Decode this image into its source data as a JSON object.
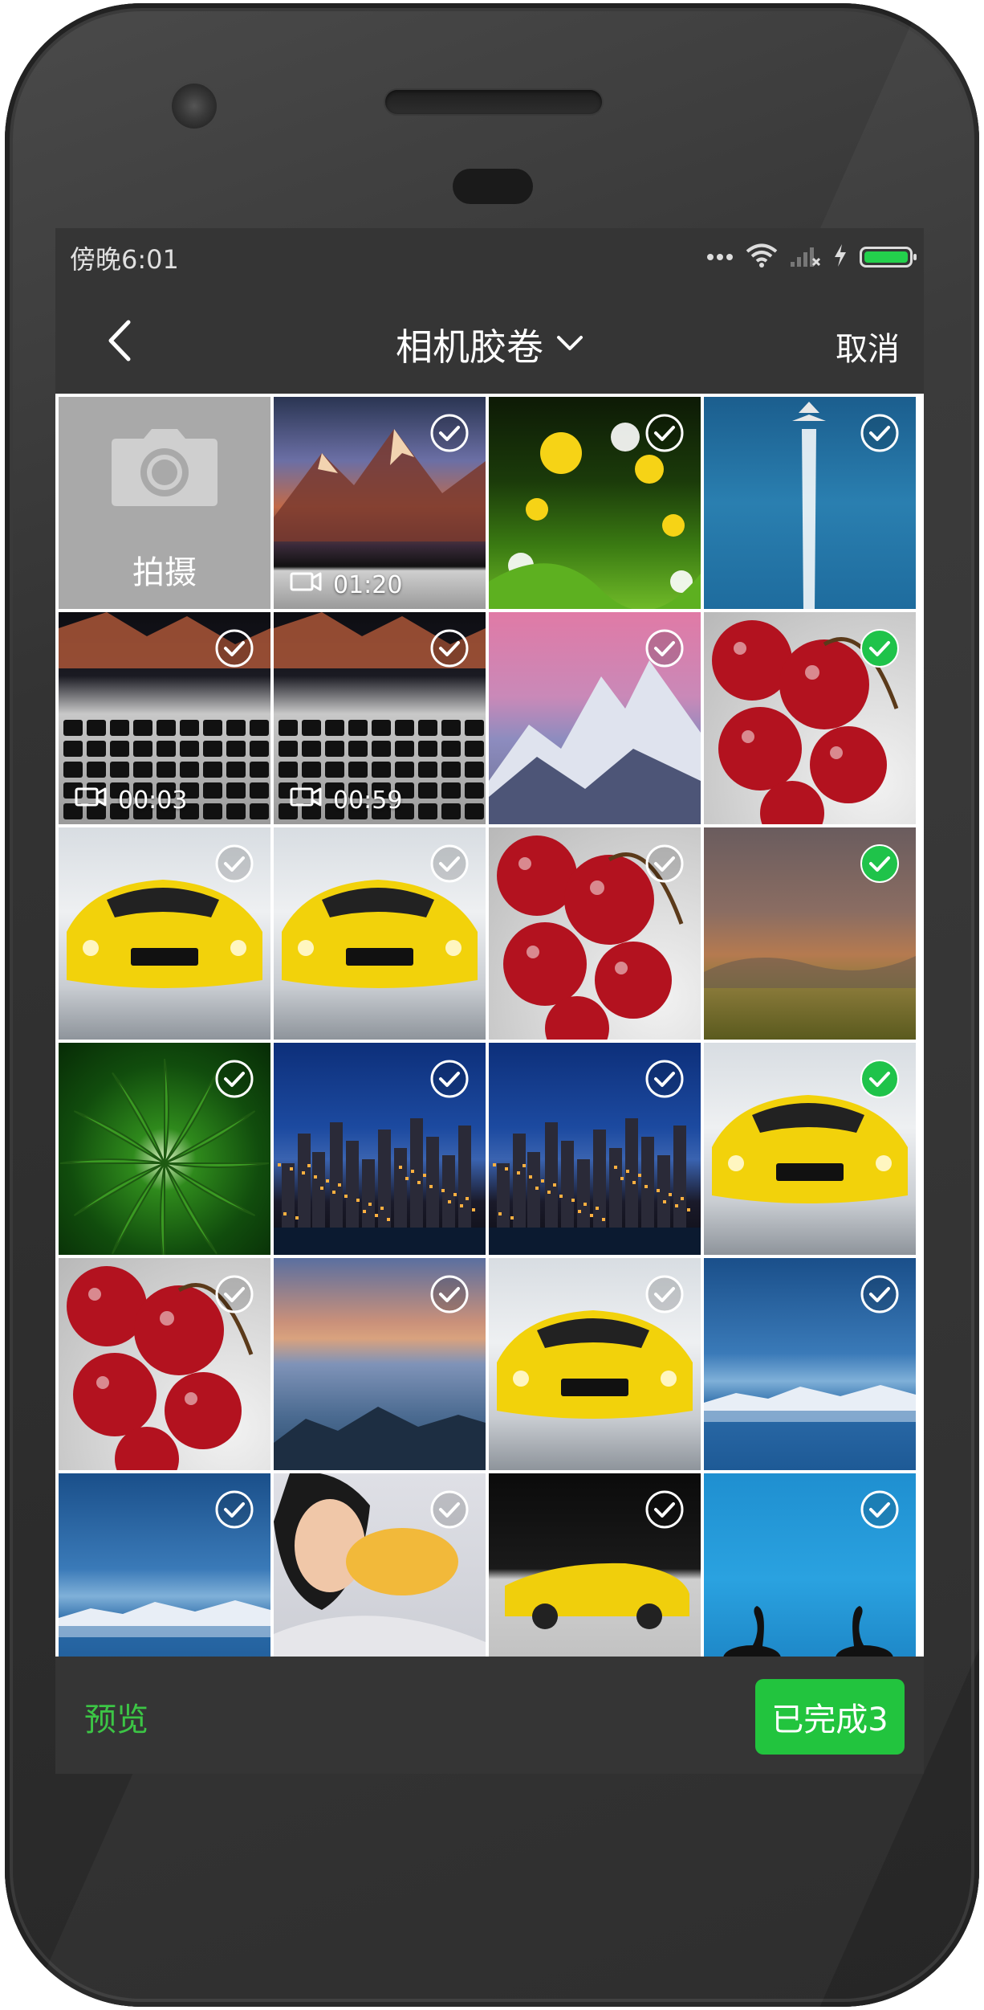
{
  "status_bar": {
    "time": "傍晚6:01",
    "battery_level": 1.0,
    "battery_color": "#23d04c"
  },
  "nav": {
    "back_icon": "chevron-left-icon",
    "title": "相机胶卷",
    "title_dropdown_icon": "chevron-down-icon",
    "cancel": "取消"
  },
  "grid": {
    "camera_label": "拍摄",
    "camera_icon": "camera-icon",
    "items": [
      {
        "subject": "mountain-laptop",
        "video_duration": "01:20",
        "selected": false
      },
      {
        "subject": "dandelions",
        "selected": false
      },
      {
        "subject": "airplane-contrail",
        "selected": false
      },
      {
        "subject": "laptop-keyboard",
        "video_duration": "00:03",
        "selected": false
      },
      {
        "subject": "laptop-keyboard",
        "video_duration": "00:59",
        "selected": false
      },
      {
        "subject": "pink-mountains",
        "selected": false
      },
      {
        "subject": "cherries",
        "selected": true
      },
      {
        "subject": "yellow-car",
        "selected": false
      },
      {
        "subject": "yellow-car",
        "selected": false
      },
      {
        "subject": "cherries",
        "selected": false
      },
      {
        "subject": "sunset-field",
        "selected": true
      },
      {
        "subject": "green-leaf",
        "selected": false
      },
      {
        "subject": "city-night",
        "selected": false
      },
      {
        "subject": "city-night",
        "selected": false
      },
      {
        "subject": "yellow-car",
        "selected": true
      },
      {
        "subject": "cherries",
        "selected": false
      },
      {
        "subject": "misty-mountains",
        "selected": false
      },
      {
        "subject": "yellow-car",
        "selected": false
      },
      {
        "subject": "snow-lake",
        "selected": false
      },
      {
        "subject": "snow-lake",
        "selected": false
      },
      {
        "subject": "woman-portrait",
        "selected": false
      },
      {
        "subject": "yellow-car-dark",
        "selected": false
      },
      {
        "subject": "swans-blue-water",
        "selected": false
      }
    ]
  },
  "bottom": {
    "preview": "预览",
    "done": "已完成3"
  },
  "colors": {
    "accent": "#22c43e",
    "selected_check": "#1fc34a",
    "bar_bg": "#353535"
  }
}
